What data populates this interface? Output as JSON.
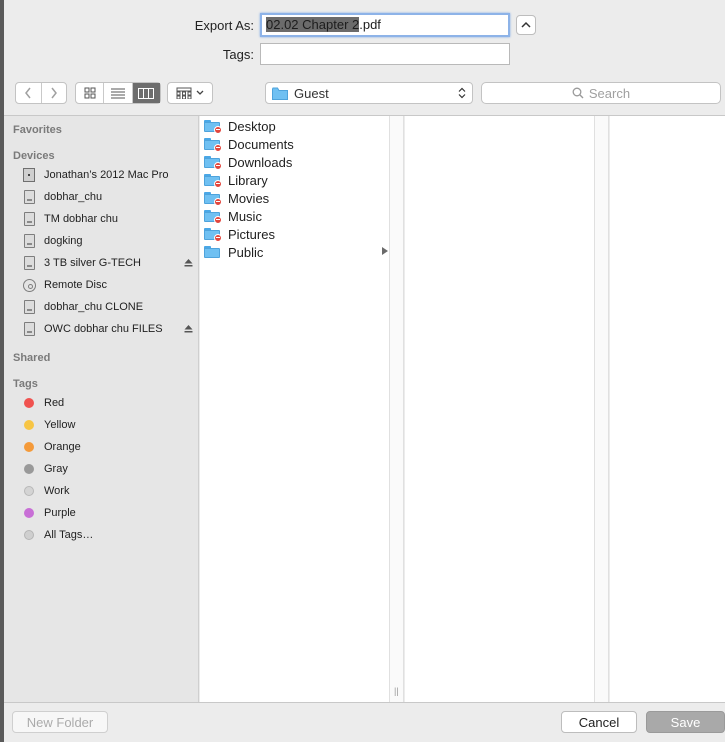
{
  "form": {
    "export_label": "Export As:",
    "export_value_selected": "02.02 Chapter 2",
    "export_value_ext": ".pdf",
    "tags_label": "Tags:",
    "tags_value": "",
    "expand_icon": "chevron-up-icon"
  },
  "toolbar": {
    "back_icon": "chevron-left-icon",
    "forward_icon": "chevron-right-icon",
    "view_modes": [
      "icon-view-icon",
      "list-view-icon",
      "column-view-icon"
    ],
    "active_view": "column-view-icon",
    "arrange_icon": "arrange-grid-icon",
    "location": "Guest",
    "search_placeholder": "Search"
  },
  "sidebar": {
    "favorites_heading": "Favorites",
    "devices_heading": "Devices",
    "devices": [
      {
        "label": "Jonathan’s 2012 Mac Pro",
        "icon": "computer-icon",
        "eject": false
      },
      {
        "label": "dobhar_chu",
        "icon": "disk-icon",
        "eject": false
      },
      {
        "label": "TM dobhar chu",
        "icon": "disk-icon",
        "eject": false
      },
      {
        "label": "dogking",
        "icon": "disk-icon",
        "eject": false
      },
      {
        "label": "3 TB silver G-TECH",
        "icon": "disk-icon",
        "eject": true
      },
      {
        "label": "Remote Disc",
        "icon": "disc-icon",
        "eject": false
      },
      {
        "label": "dobhar_chu CLONE",
        "icon": "disk-icon",
        "eject": false
      },
      {
        "label": "OWC dobhar chu FILES",
        "icon": "disk-icon",
        "eject": true
      }
    ],
    "shared_heading": "Shared",
    "tags_heading": "Tags",
    "tags": [
      {
        "label": "Red",
        "color": "#f0524f"
      },
      {
        "label": "Yellow",
        "color": "#f7c544"
      },
      {
        "label": "Orange",
        "color": "#f49a3a"
      },
      {
        "label": "Gray",
        "color": "#999999"
      },
      {
        "label": "Work",
        "color": "#d4d4d4"
      },
      {
        "label": "Purple",
        "color": "#c86fd6"
      },
      {
        "label": "All Tags…",
        "color": "#cfcfcf"
      }
    ]
  },
  "columns": {
    "first": [
      {
        "name": "Desktop",
        "badge": true,
        "has_children": false
      },
      {
        "name": "Documents",
        "badge": true,
        "has_children": false
      },
      {
        "name": "Downloads",
        "badge": true,
        "has_children": false
      },
      {
        "name": "Library",
        "badge": true,
        "has_children": false
      },
      {
        "name": "Movies",
        "badge": true,
        "has_children": false
      },
      {
        "name": "Music",
        "badge": true,
        "has_children": false
      },
      {
        "name": "Pictures",
        "badge": true,
        "has_children": false
      },
      {
        "name": "Public",
        "badge": false,
        "has_children": true
      }
    ]
  },
  "buttons": {
    "new_folder": "New Folder",
    "cancel": "Cancel",
    "save": "Save"
  }
}
